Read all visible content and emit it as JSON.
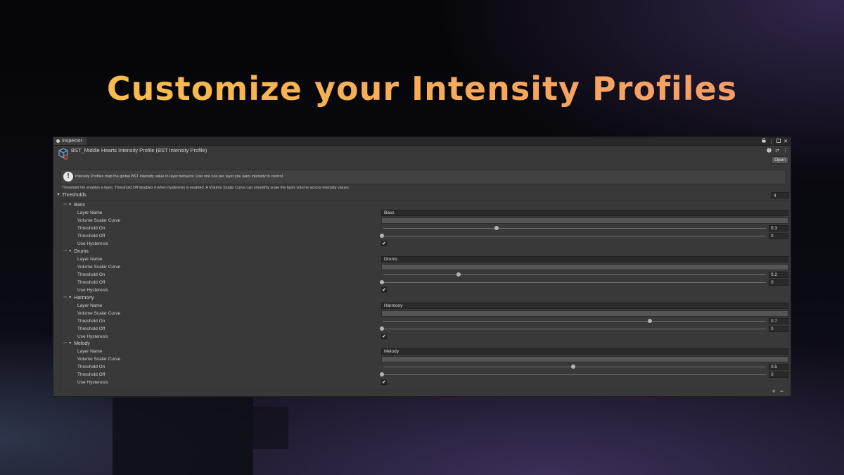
{
  "headline": "Customize your Intensity Profiles",
  "inspector": {
    "tab_label": "Inspector",
    "asset_title": "BST_Middle Hearts Intensity Profile (BST Intensity Profile)",
    "open_label": "Open",
    "info_text": "Intensity Profiles map the global BST intensity value to layer behavior. Use one rule per layer you want intensity to control.",
    "description": "Threshold On enables a layer. Threshold Off disables it when hysteresis is enabled. A Volume Scalar Curve can smoothly scale the layer volume across intensity values.",
    "thresholds_label": "Thresholds",
    "thresholds_count": "4",
    "field_labels": {
      "layer_name": "Layer Name",
      "volume_curve": "Volume Scalar Curve",
      "threshold_on": "Threshold On",
      "threshold_off": "Threshold Off",
      "use_hysteresis": "Use Hysteresis"
    },
    "elements": [
      {
        "name": "Bass",
        "layer_name": "Bass",
        "threshold_on": "0.3",
        "threshold_off": "0",
        "use_hysteresis": true
      },
      {
        "name": "Drums",
        "layer_name": "Drums",
        "threshold_on": "0.2",
        "threshold_off": "0",
        "use_hysteresis": true
      },
      {
        "name": "Harmony",
        "layer_name": "Harmony",
        "threshold_on": "0.7",
        "threshold_off": "0",
        "use_hysteresis": true
      },
      {
        "name": "Melody",
        "layer_name": "Melody",
        "threshold_on": "0.5",
        "threshold_off": "0",
        "use_hysteresis": true
      }
    ],
    "add_label": "+",
    "remove_label": "−",
    "check_glyph": "✔",
    "info_glyph": "!"
  }
}
